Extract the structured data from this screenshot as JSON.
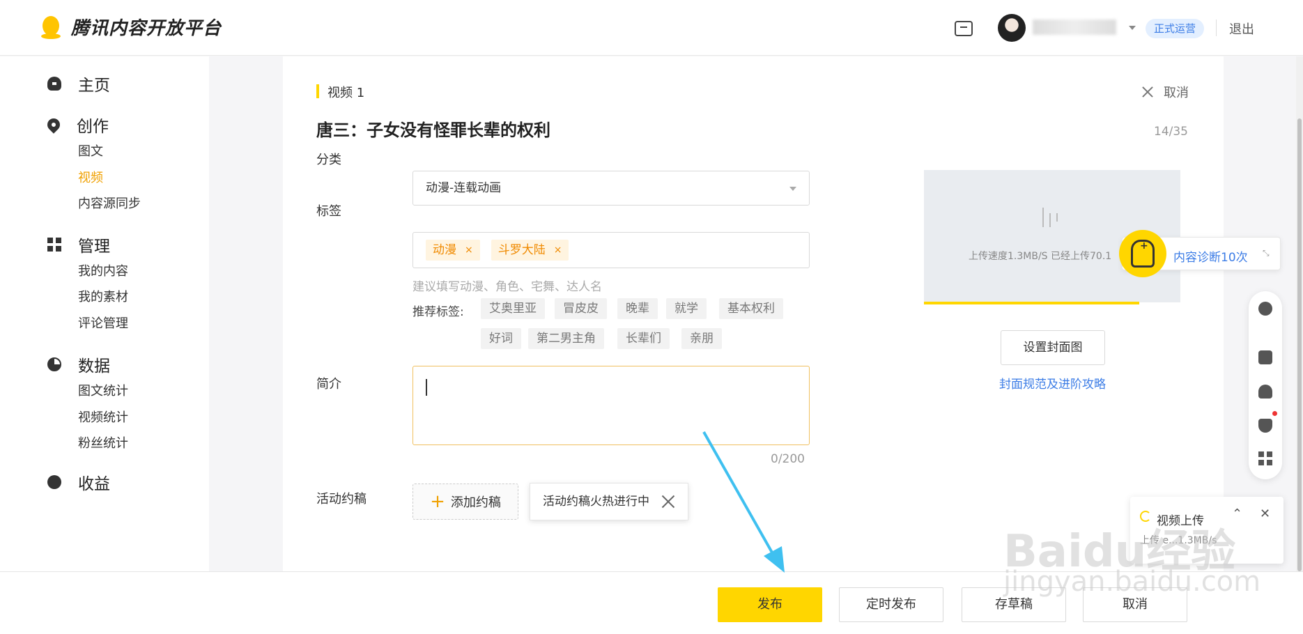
{
  "header": {
    "brand": "腾讯内容开放平台",
    "status_badge": "正式运营",
    "logout": "退出",
    "username_partial": "·能·"
  },
  "sidebar": {
    "groups": [
      {
        "label": "主页",
        "icon": "home-icon"
      },
      {
        "label": "创作",
        "icon": "pin-icon",
        "items": [
          "图文",
          "视频",
          "内容源同步"
        ]
      },
      {
        "label": "管理",
        "icon": "grid-icon",
        "items": [
          "我的内容",
          "我的素材",
          "评论管理"
        ]
      },
      {
        "label": "数据",
        "icon": "pie-icon",
        "items": [
          "图文统计",
          "视频统计",
          "粉丝统计"
        ]
      },
      {
        "label": "收益",
        "icon": "coin-icon"
      }
    ],
    "active_item": "视频"
  },
  "editor": {
    "section_label": "视频 1",
    "cancel": "取消",
    "title": "唐三：子女没有怪罪长辈的权利",
    "title_count": "14/35",
    "category_label": "分类",
    "category_value": "动漫-连载动画",
    "tags_label": "标签",
    "tags": [
      "动漫",
      "斗罗大陆"
    ],
    "tag_remove": "×",
    "tag_hint": "建议填写动漫、角色、宅舞、达人名",
    "recommend_label": "推荐标签:",
    "recommended_tags": [
      "艾奥里亚",
      "冒皮皮",
      "晚辈",
      "就学",
      "基本权利",
      "好词",
      "第二男主角",
      "长辈们",
      "亲朋"
    ],
    "desc_label": "简介",
    "desc_value": "",
    "desc_count": "0/200",
    "activity_label": "活动约稿",
    "add_activity": "添加约稿",
    "activity_popover": "活动约稿火热进行中"
  },
  "cover": {
    "upload_status": "上传速度1.3MB/S 已经上传70.1",
    "progress": 0.84,
    "set_cover": "设置封面图",
    "guide_link": "封面规范及进阶攻略"
  },
  "diagnosis": {
    "label": "内容诊断10次"
  },
  "upload_panel": {
    "title": "视频上传",
    "subtitle": "上传 e...1.3MB/s"
  },
  "footer": {
    "publish": "发布",
    "schedule": "定时发布",
    "draft": "存草稿",
    "cancel": "取消"
  },
  "watermark": {
    "main": "Baidu经验",
    "sub": "jingyan.baidu.com"
  },
  "colors": {
    "accent": "#ffd600",
    "link": "#3b7ce6",
    "active_nav": "#f0a000",
    "arrow": "#3fc0f0"
  }
}
